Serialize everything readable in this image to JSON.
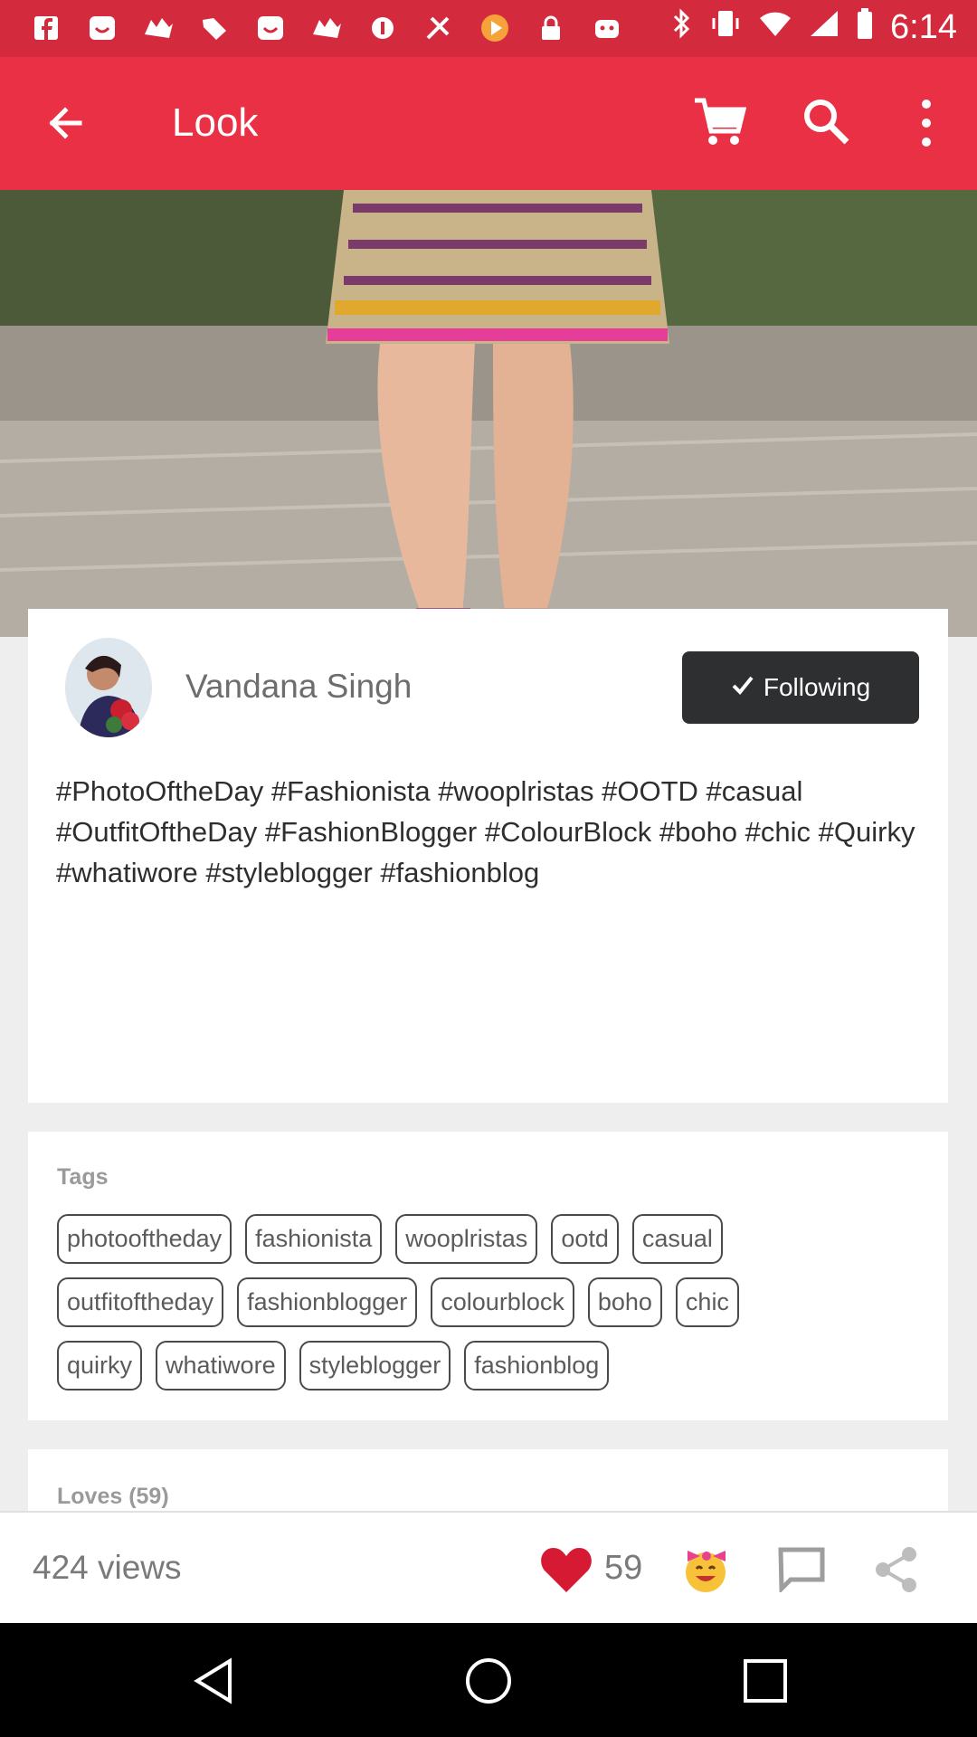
{
  "app_bar": {
    "title": "Look",
    "icons": [
      "back-arrow-icon",
      "cart-icon",
      "search-icon",
      "more-vert-icon"
    ]
  },
  "status_bar": {
    "time": "6:14"
  },
  "post": {
    "author": "Vandana Singh",
    "follow_label": "Following",
    "caption": "#PhotoOftheDay #Fashionista #wooplristas #OOTD #casual #OutfitOftheDay #FashionBlogger #ColourBlock #boho #chic #Quirky #whatiwore #styleblogger #fashionblog"
  },
  "tags": {
    "title": "Tags",
    "items": [
      "photooftheday",
      "fashionista",
      "wooplristas",
      "ootd",
      "casual",
      "outfitoftheday",
      "fashionblogger",
      "colourblock",
      "boho",
      "chic",
      "quirky",
      "whatiwore",
      "styleblogger",
      "fashionblog"
    ]
  },
  "loves": {
    "title": "Loves (59)"
  },
  "bottom_bar": {
    "views": "424 views",
    "loves_count": "59"
  },
  "colors": {
    "brand": "#e93045",
    "status_bar": "#d42a3e",
    "follow_button": "#2d2f30",
    "heart": "#d61a33"
  }
}
